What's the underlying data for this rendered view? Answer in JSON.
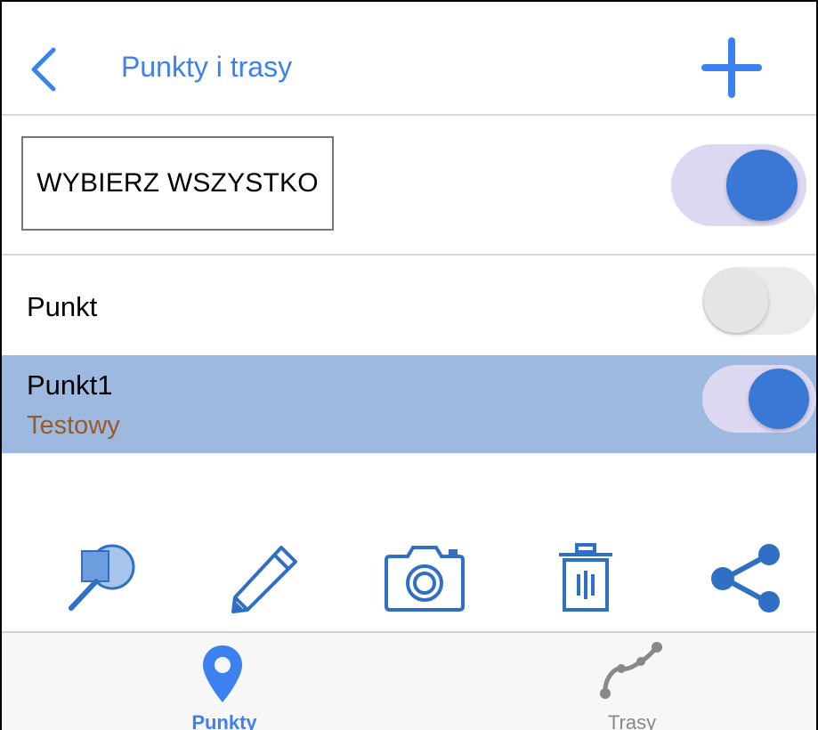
{
  "header": {
    "title": "Punkty i trasy",
    "back_icon": "chevron-left-icon",
    "add_icon": "plus-icon"
  },
  "select_all": {
    "label": "WYBIERZ WSZYSTKO",
    "toggle_on": true
  },
  "points": [
    {
      "name": "Punkt",
      "subtitle": "",
      "toggle_on": false,
      "selected": false
    },
    {
      "name": "Punkt1",
      "subtitle": "Testowy",
      "toggle_on": true,
      "selected": true
    }
  ],
  "toolbar": [
    {
      "icon": "magnify-layers-icon"
    },
    {
      "icon": "pencil-icon"
    },
    {
      "icon": "camera-icon"
    },
    {
      "icon": "trash-icon"
    },
    {
      "icon": "share-icon"
    }
  ],
  "tabs": [
    {
      "label": "Punkty",
      "icon": "map-pin-icon",
      "active": true
    },
    {
      "label": "Trasy",
      "icon": "route-icon",
      "active": false
    }
  ],
  "colors": {
    "accent": "#3b82f0",
    "icon_blue": "#2f6fc4",
    "selected_row": "#9db9df",
    "subtitle": "#9a5a28",
    "tab_inactive": "#888888"
  }
}
